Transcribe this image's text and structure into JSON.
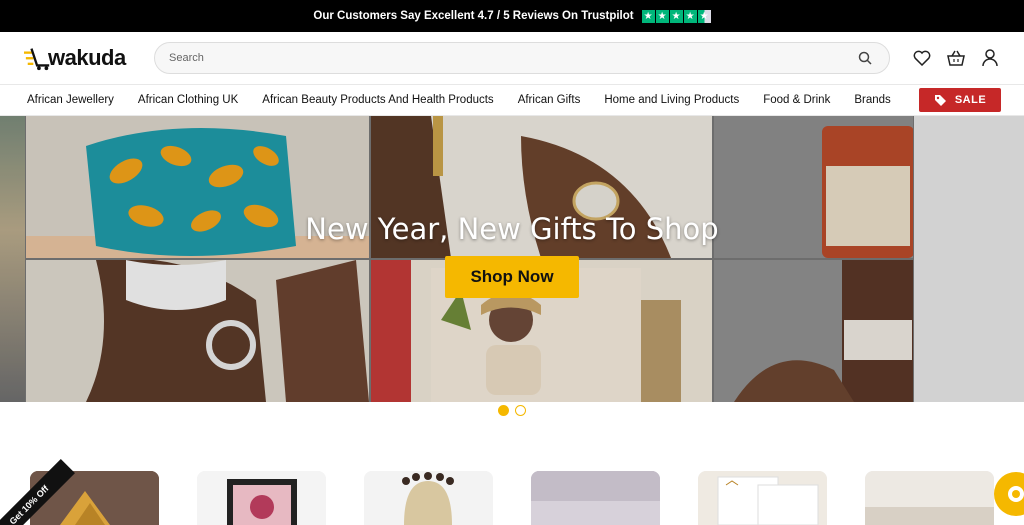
{
  "topbar": {
    "text": "Our Customers Say Excellent 4.7 / 5 Reviews On Trustpilot",
    "rating": 4.5
  },
  "header": {
    "logo_text": "wakuda",
    "search_placeholder": "Search",
    "icons": [
      "search-icon",
      "heart-icon",
      "basket-icon",
      "user-icon"
    ]
  },
  "nav": {
    "items": [
      "African Jewellery",
      "African Clothing UK",
      "African Beauty Products And Health Products",
      "African Gifts",
      "Home and Living Products",
      "Food & Drink",
      "Brands"
    ],
    "sale_label": "SALE"
  },
  "hero": {
    "title": "New Year, New Gifts To Shop",
    "cta": "Shop Now"
  },
  "carousel": {
    "slides": 2,
    "active": 1
  },
  "promo": {
    "ribbon": "Get 10% Off"
  },
  "colors": {
    "accent": "#f5b800",
    "sale": "#c62828",
    "trustpilot": "#00b67a"
  }
}
